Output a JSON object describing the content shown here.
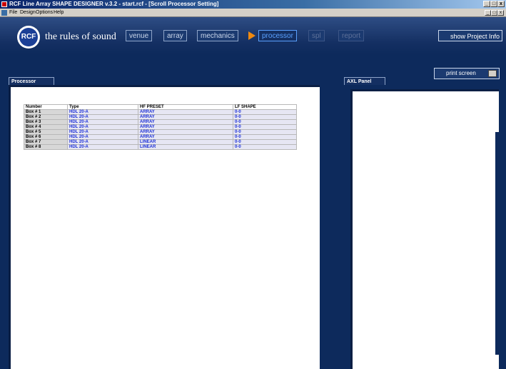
{
  "window": {
    "title": "RCF Line Array SHAPE DESIGNER v.3.2 - start.rcf - [Scroll Processor Setting]",
    "controls": [
      "_",
      "□",
      "x"
    ]
  },
  "menu": {
    "items": [
      "File",
      "Design",
      "Options",
      "Help"
    ]
  },
  "header": {
    "logo_text": "RCF",
    "tagline": "the rules of sound",
    "tabs": [
      {
        "label": "venue"
      },
      {
        "label": "array"
      },
      {
        "label": "mechanics"
      },
      {
        "label": "processor",
        "active": true
      },
      {
        "label": "spl"
      },
      {
        "label": "report"
      }
    ],
    "show_project_label": "show Project Info"
  },
  "print_button": {
    "label": "print screen"
  },
  "processor_panel": {
    "tab_label": "Processor",
    "table": {
      "headers": [
        "Number",
        "Type",
        "HF PRESET",
        "LF SHAPE"
      ],
      "rows": [
        [
          "Box # 1",
          "HDL 20-A",
          "ARRAY",
          "0-0"
        ],
        [
          "Box # 2",
          "HDL 20-A",
          "ARRAY",
          "0-0"
        ],
        [
          "Box # 3",
          "HDL 20-A",
          "ARRAY",
          "0-0"
        ],
        [
          "Box # 4",
          "HDL 20-A",
          "ARRAY",
          "0-0"
        ],
        [
          "Box # 5",
          "HDL 20-A",
          "ARRAY",
          "0-0"
        ],
        [
          "Box # 6",
          "HDL 20-A",
          "ARRAY",
          "0-0"
        ],
        [
          "Box # 7",
          "HDL 20-A",
          "LINEAR",
          "0-0"
        ],
        [
          "Box # 8",
          "HDL 20-A",
          "LINEAR",
          "0-0"
        ]
      ]
    }
  },
  "axl_panel": {
    "tab_label": "AXL Panel"
  },
  "colors": {
    "background": "#0d2a5c",
    "accent": "#5aa0ff",
    "arrow": "#f08a10",
    "value_text": "#1e32d8"
  }
}
